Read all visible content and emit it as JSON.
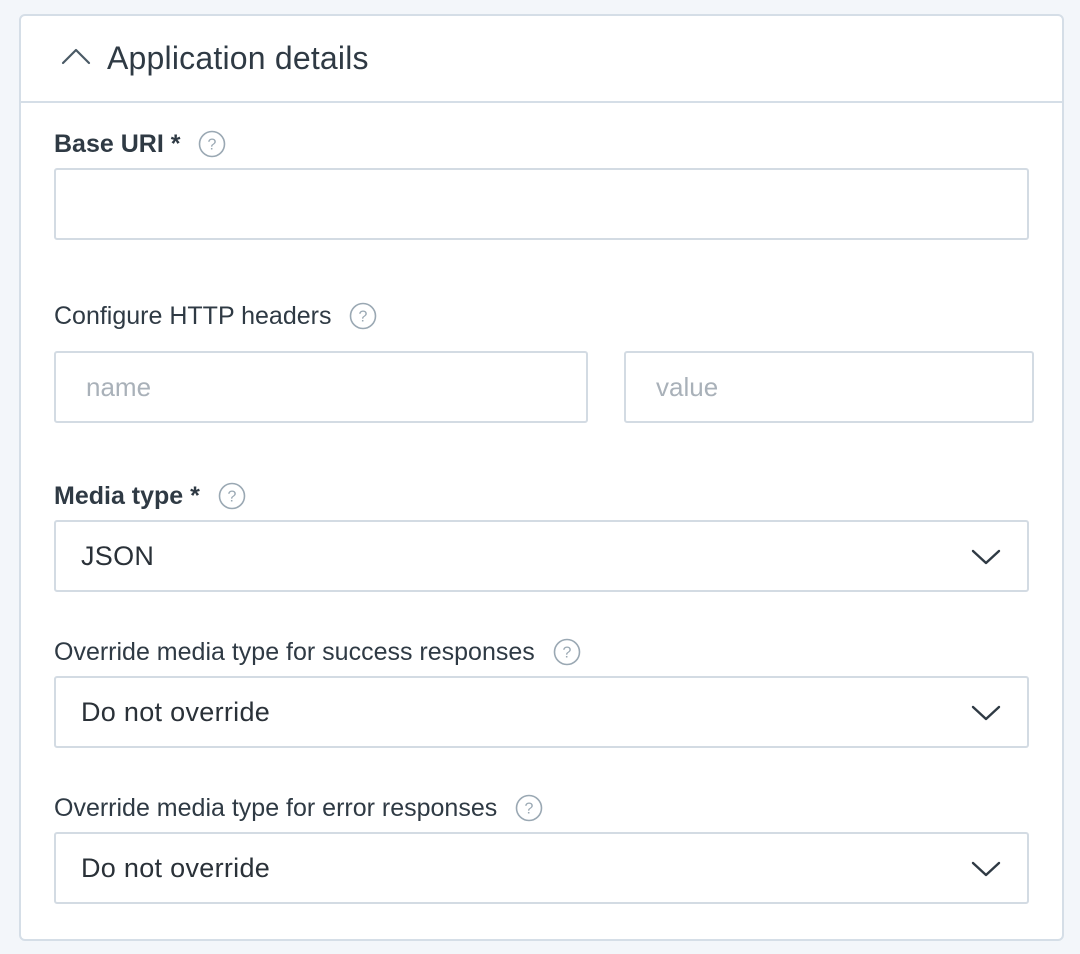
{
  "panel": {
    "title": "Application details",
    "toggle_icon": "chevron-up-icon"
  },
  "base_uri": {
    "label": "Base URI *",
    "value": "",
    "help_icon": "question-circle-icon"
  },
  "http_headers": {
    "label": "Configure HTTP headers",
    "name_placeholder": "name",
    "value_placeholder": "value",
    "help_icon": "question-circle-icon"
  },
  "media_type": {
    "label": "Media type *",
    "selected": "JSON",
    "help_icon": "question-circle-icon"
  },
  "success_override": {
    "label": "Override media type for success responses",
    "selected": "Do not override",
    "help_icon": "question-circle-icon"
  },
  "error_override": {
    "label": "Override media type for error responses",
    "selected": "Do not override",
    "help_icon": "question-circle-icon"
  },
  "colors": {
    "border": "#d5dee7",
    "text": "#2f3a44",
    "placeholder": "#a9b1b9",
    "icon": "#8fa0ad"
  }
}
